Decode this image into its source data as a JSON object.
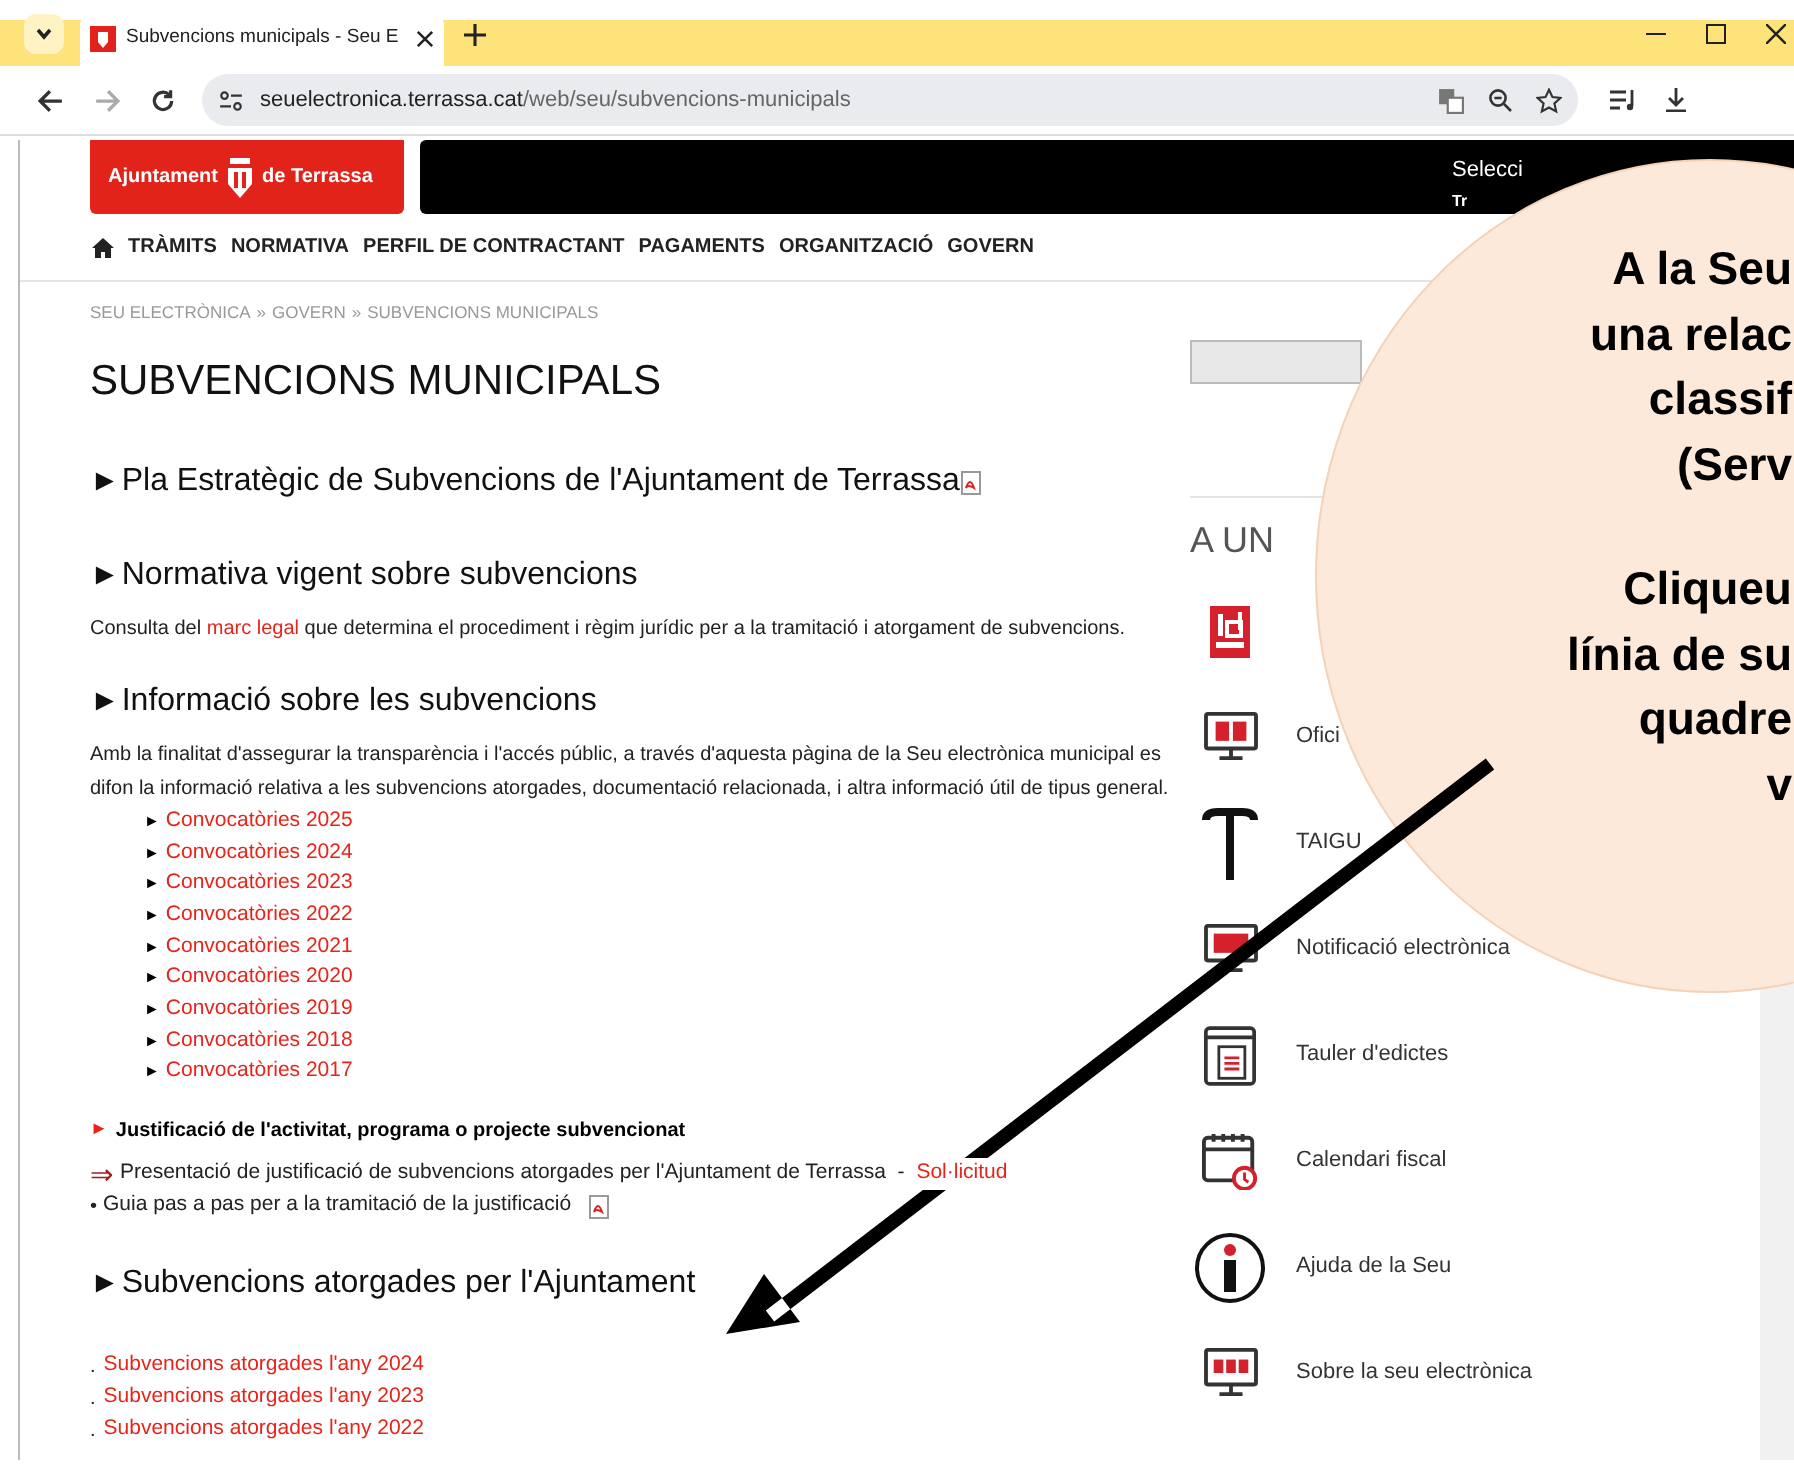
{
  "browser": {
    "tab_title": "Subvencions municipals - Seu E",
    "url_host": "seuelectronica.terrassa.cat",
    "url_path": "/web/seu/subvencions-municipals"
  },
  "header": {
    "logo_left": "Ajuntament",
    "logo_right": "de Terrassa",
    "bar_texts": [
      "Selecci",
      "Tr"
    ]
  },
  "nav": [
    "TRÀMITS",
    "NORMATIVA",
    "PERFIL DE CONTRACTANT",
    "PAGAMENTS",
    "ORGANITZACIÓ",
    "GOVERN"
  ],
  "breadcrumb": {
    "separator": "»",
    "items": [
      "SEU ELECTRÒNICA",
      "GOVERN",
      "SUBVENCIONS MUNICIPALS"
    ]
  },
  "title": "SUBVENCIONS MUNICIPALS",
  "blocks": [
    {
      "kind": "heading",
      "marker": "►",
      "text": "Pla Estratègic de Subvencions de l'Ajuntament de Terrassa",
      "pdf": true
    },
    {
      "kind": "heading",
      "marker": "►",
      "text": "Normativa vigent sobre subvencions"
    },
    {
      "kind": "paragraph",
      "parts": [
        {
          "text": "Consulta del "
        },
        {
          "text": "marc legal",
          "link": true
        },
        {
          "text": " que determina el procediment i règim jurídic per a la tramitació i atorgament de subvencions."
        }
      ]
    },
    {
      "kind": "heading",
      "marker": "►",
      "text": "Informació sobre les subvencions"
    },
    {
      "kind": "paragraph",
      "parts": [
        {
          "text": "Amb la finalitat d'assegurar la transparència i l'accés públic, a través d'aquesta pàgina de la Seu electrònica municipal es difon la informació relativa a les subvencions atorgades, documentació relacionada, i altra informació útil de tipus general."
        }
      ]
    },
    {
      "kind": "link_list",
      "marker": "►",
      "items": [
        "Convocatòries 2025",
        "Convocatòries 2024",
        "Convocatòries 2023",
        "Convocatòries 2022",
        "Convocatòries 2021",
        "Convocatòries 2020",
        "Convocatòries 2019",
        "Convocatòries 2018",
        "Convocatòries 2017"
      ]
    },
    {
      "kind": "subheading",
      "marker": "►",
      "text": "Justificació de l'activitat, programa o projecte subvencionat"
    },
    {
      "kind": "arrow_line",
      "marker": "⇒",
      "text": "Presentació de justificació de subvencions atorgades per l'Ajuntament de Terrassa  - ",
      "link": "Sol·licitud"
    },
    {
      "kind": "bullet_line",
      "marker": "•",
      "text": "Guia pas a pas per a la tramitació de la justificació",
      "pdf": true
    },
    {
      "kind": "heading",
      "marker": "►",
      "text": "Subvencions atorgades per l'Ajuntament"
    },
    {
      "kind": "dot_list",
      "marker": ".",
      "items": [
        "Subvencions atorgades l'any 2024",
        "Subvencions atorgades l'any 2023",
        "Subvencions atorgades l'any 2022"
      ]
    }
  ],
  "sidebar": {
    "heading": "A UN",
    "items": [
      {
        "kind": "icon_only"
      },
      {
        "kind": "link",
        "label": "Ofici"
      },
      {
        "kind": "link",
        "label": "TAIGU"
      },
      {
        "kind": "link",
        "label": "Notificació electrònica"
      },
      {
        "kind": "link",
        "label": "Tauler d'edictes"
      },
      {
        "kind": "link",
        "label": "Calendari fiscal"
      },
      {
        "kind": "link",
        "label": "Ajuda de la Seu"
      },
      {
        "kind": "link",
        "label": "Sobre la seu electrònica"
      }
    ]
  },
  "callout": {
    "paragraphs": [
      [
        "A la Seu",
        "una relac",
        "classif",
        "(Serv"
      ],
      [
        "Cliqueu",
        "línia de su",
        "quadre",
        "v"
      ]
    ]
  }
}
